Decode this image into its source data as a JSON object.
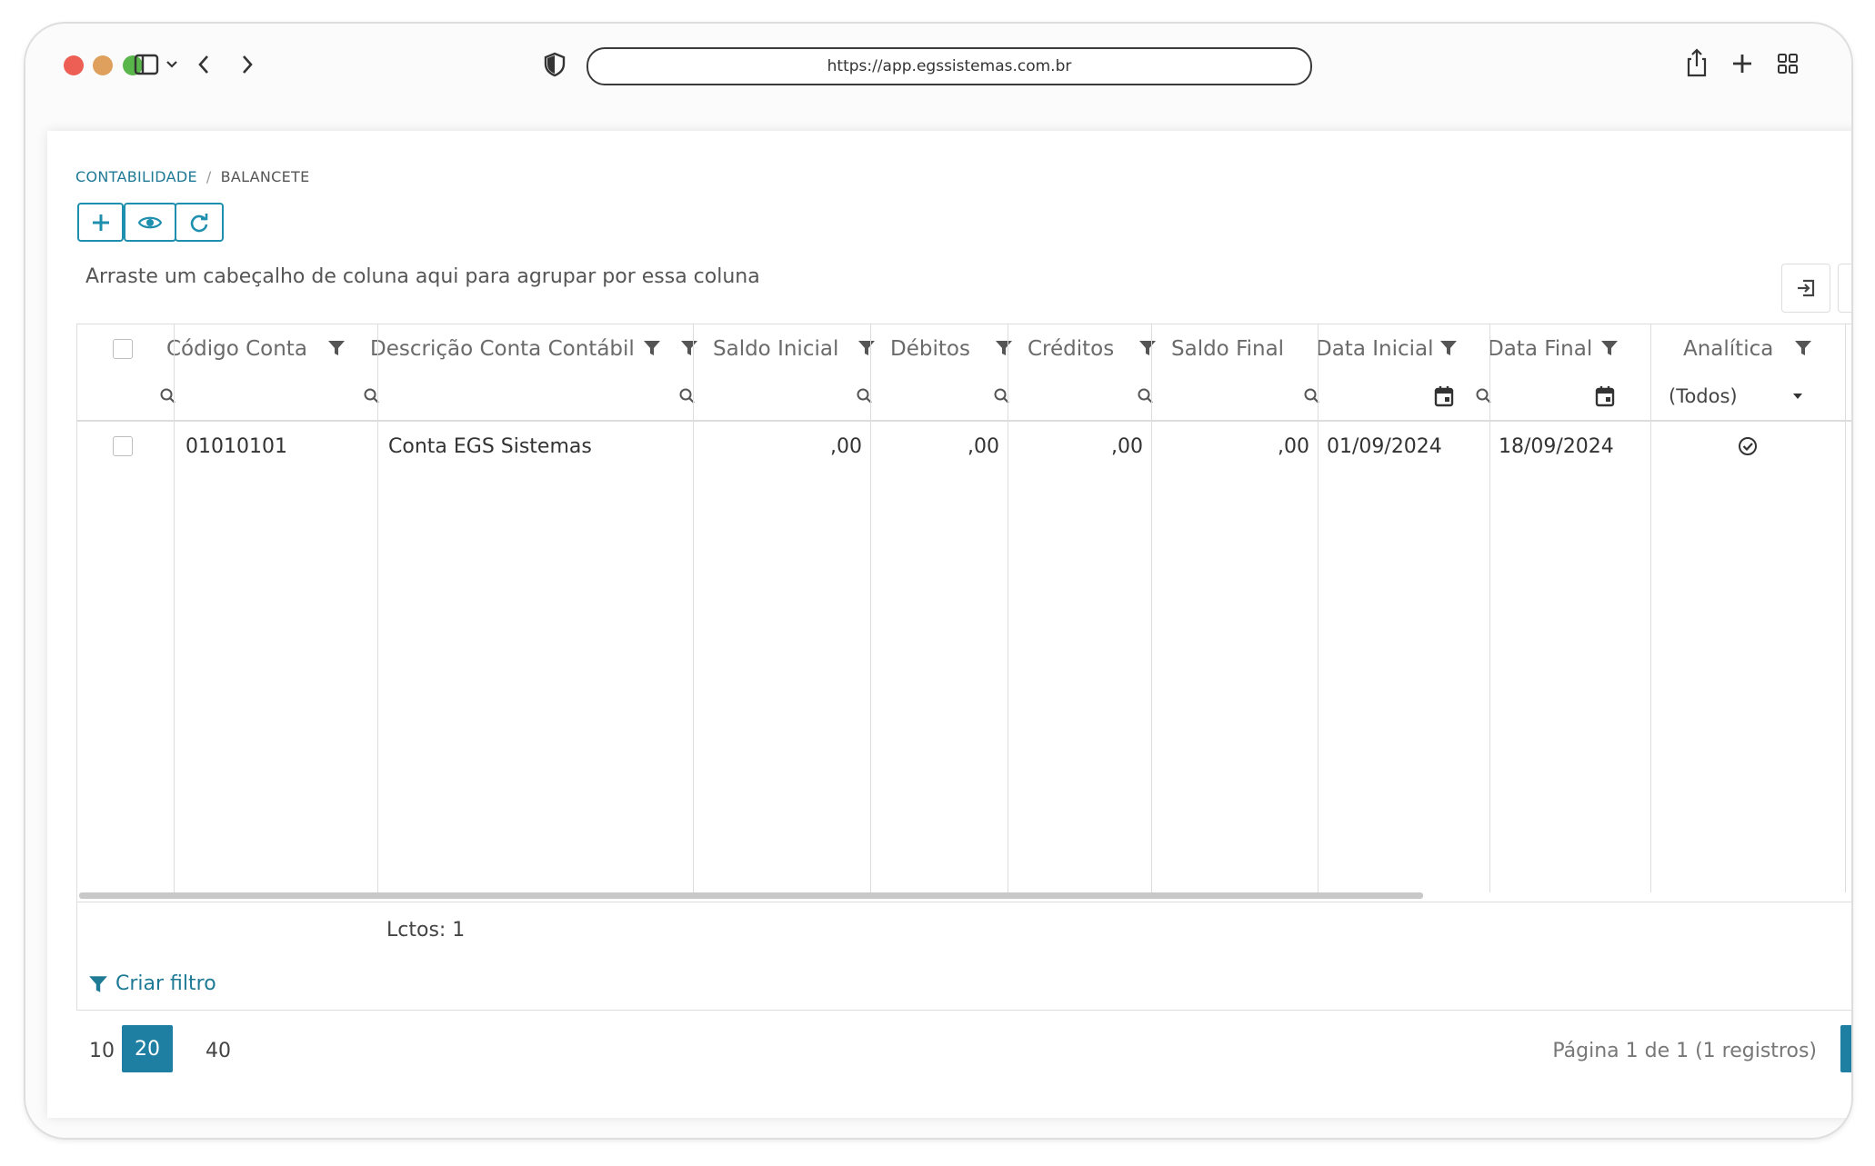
{
  "browser": {
    "url": "https://app.egssistemas.com.br"
  },
  "breadcrumb": {
    "module": "CONTABILIDADE",
    "separator": "/",
    "page": "BALANCETE"
  },
  "toolbar": {
    "add_icon": "plus-icon",
    "view_icon": "eye-icon",
    "refresh_icon": "refresh-icon"
  },
  "grid": {
    "group_panel_text": "Arraste um cabeçalho de coluna aqui para agrupar por essa coluna",
    "columns": [
      "Código Conta",
      "Descrição Conta Contábil",
      "Saldo Inicial",
      "Débitos",
      "Créditos",
      "Saldo Final",
      "Data Inicial",
      "Data Final",
      "Analítica"
    ],
    "filter_select_value": "(Todos)",
    "rows": [
      {
        "codigo": "01010101",
        "descricao": "Conta EGS Sistemas",
        "saldo_inicial": ",00",
        "debitos": ",00",
        "creditos": ",00",
        "saldo_final": ",00",
        "data_inicial": "01/09/2024",
        "data_final": "18/09/2024",
        "analitica": true
      }
    ],
    "summary": "Lctos: 1",
    "create_filter": "Criar filtro"
  },
  "pager": {
    "sizes": [
      "10",
      "20",
      "40"
    ],
    "active_size": "20",
    "info": "Página 1 de 1 (1 registros)"
  },
  "colors": {
    "accent": "#1f7fa3",
    "breadcrumb": "#1f7a96"
  }
}
